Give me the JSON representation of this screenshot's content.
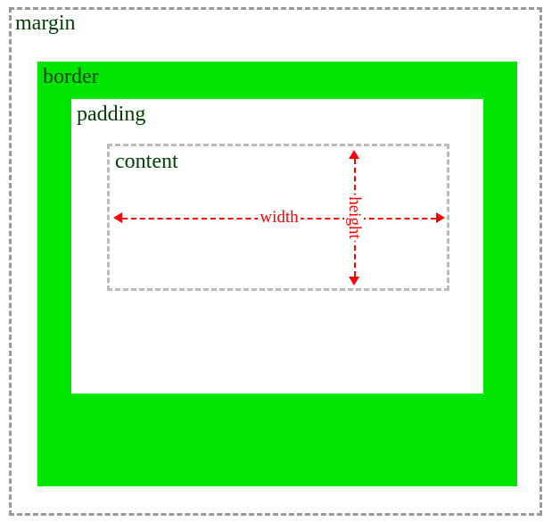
{
  "labels": {
    "margin": "margin",
    "border": "border",
    "padding": "padding",
    "content": "content",
    "width": "width",
    "height": "height"
  },
  "colors": {
    "border_fill": "#00e600",
    "dashed_outline": "#999999",
    "text": "#004000",
    "arrow": "#ff0000"
  }
}
